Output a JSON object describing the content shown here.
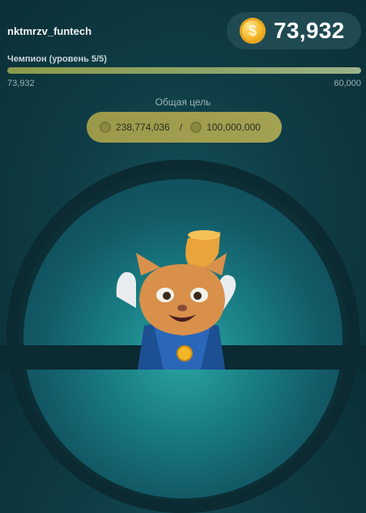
{
  "header": {
    "username": "nktmrzv_funtech",
    "balance": "73,932",
    "coin_icon": "coin-icon"
  },
  "level": {
    "label": "Чемпион (уровень 5/5)",
    "current": "73,932",
    "max": "60,000",
    "progress_fraction": 1.0
  },
  "goal": {
    "label": "Общая цель",
    "current": "238,774,036",
    "separator": "/",
    "target": "100,000,000"
  },
  "colors": {
    "background": "#0f3d45",
    "progress": "#8fa56a",
    "goal_pill": "#a09e4e",
    "coin": "#f4b626"
  }
}
